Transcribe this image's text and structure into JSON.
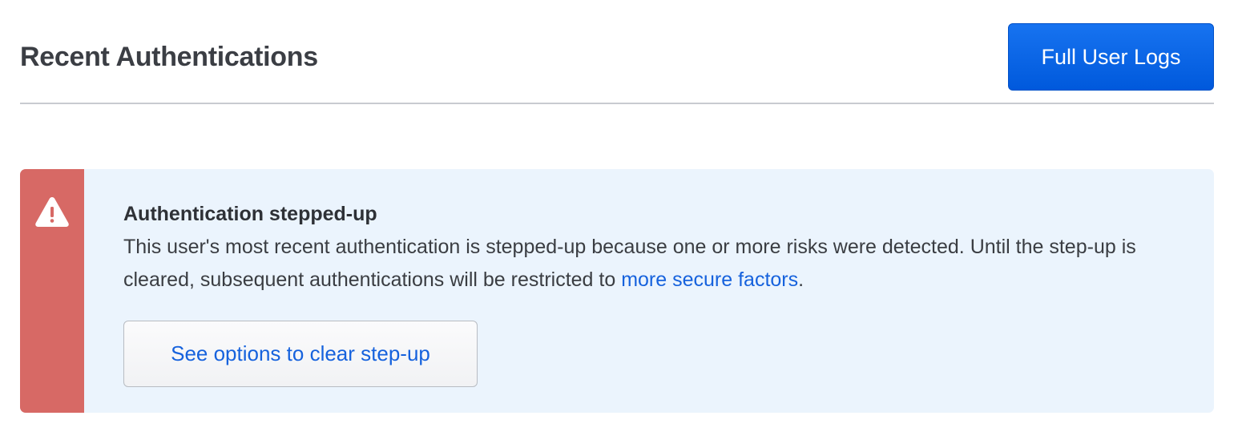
{
  "header": {
    "title": "Recent Authentications",
    "full_logs_label": "Full User Logs"
  },
  "alert": {
    "icon": "warning-triangle-icon",
    "stripe_color": "#d76965",
    "background_color": "#ebf4fd",
    "title": "Authentication stepped-up",
    "message_before_link": "This user's most recent authentication is stepped-up because one or more risks were detected. Until the step-up is cleared, subsequent authentications will be restricted to ",
    "link_text": "more secure factors",
    "message_after_link": ".",
    "action_label": "See options to clear step-up"
  },
  "colors": {
    "primary": "#0b66e4",
    "link": "#1662dd"
  }
}
